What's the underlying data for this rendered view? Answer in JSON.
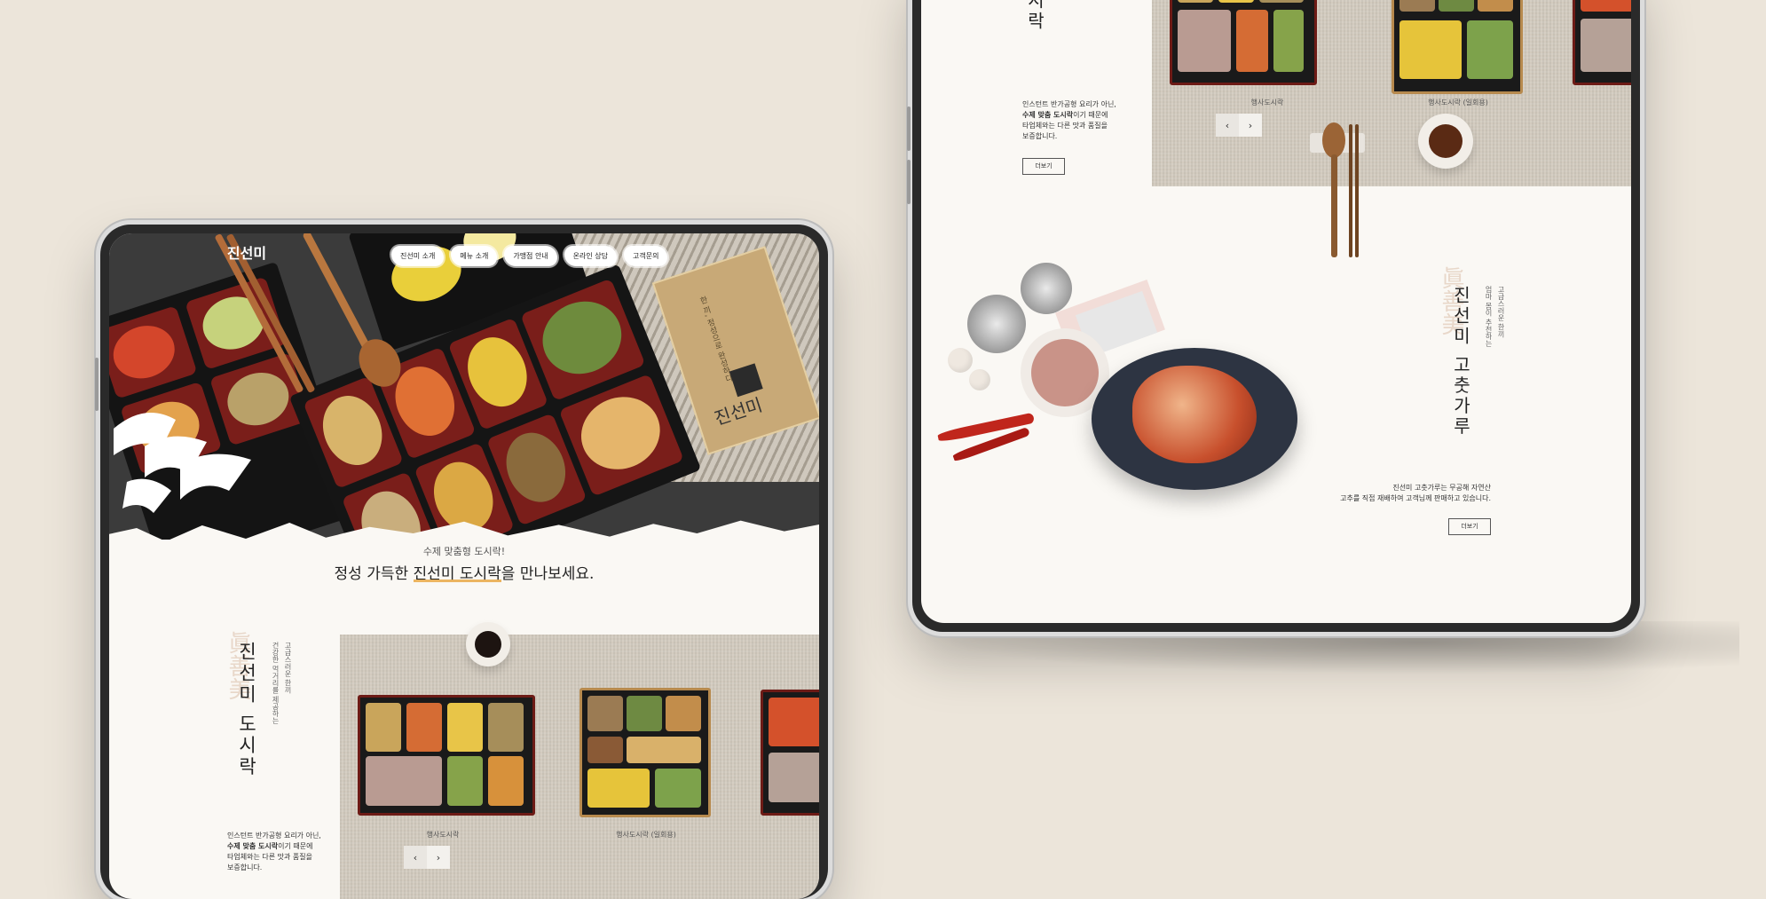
{
  "left_tablet": {
    "logo": "진선미",
    "nav": [
      "진선미 소개",
      "메뉴 소개",
      "가맹점 안내",
      "온라인 상담",
      "고객문의"
    ],
    "hero_card": {
      "text": "한 끼, 정성으로 완성하다",
      "brand": "진선미"
    },
    "tagline_small": "수제 맞춤형 도시락!",
    "tagline_big_pre": "정성 가득한 ",
    "tagline_big_highlight": "진선미 도시락",
    "tagline_big_post": "을 만나보세요.",
    "section": {
      "hanja": "眞善美",
      "title": "진선미 도시락",
      "sub_lines": [
        "고급스러운 한끼",
        "건강한 먹거리를 제공하는"
      ],
      "desc_line1": "인스턴트 반가공형 요리가 아닌,",
      "desc_line2_bold": "수제 맞춤 도시락",
      "desc_line2_rest": "이기 때문에",
      "desc_line3": "타업체와는 다른 맛과 품질을",
      "desc_line4": "보증합니다.",
      "captions": [
        "행사도시락",
        "행사도시락 (일회용)"
      ]
    }
  },
  "right_tablet": {
    "top_section": {
      "title_tail": "시락",
      "desc_line1": "인스턴트 반가공형 요리가 아닌,",
      "desc_line2_bold": "수제 맞춤 도시락",
      "desc_line2_rest": "이기 때문에",
      "desc_line3": "타업체와는 다른 맛과 품질을",
      "desc_line4": "보증합니다.",
      "more": "더보기",
      "captions": [
        "행사도시락",
        "행사도시락 (일회용)"
      ]
    },
    "gochu_section": {
      "hanja": "眞善美",
      "title": "진선미 고춧가루",
      "sub_lines": [
        "고급스러운 한끼",
        "엄마 몸이 추천하는"
      ],
      "desc_line1": "진선미 고춧가루는 무공해 자연산",
      "desc_line2": "고추를 직접 재배하여 고객님께 판매하고 있습니다.",
      "more": "더보기"
    }
  },
  "arrows": {
    "prev": "‹",
    "next": "›"
  },
  "colors": {
    "background": "#ece5da",
    "screen": "#faf8f4",
    "accent_underline": "#e9a43c",
    "tray_red": "#6d1b16"
  }
}
